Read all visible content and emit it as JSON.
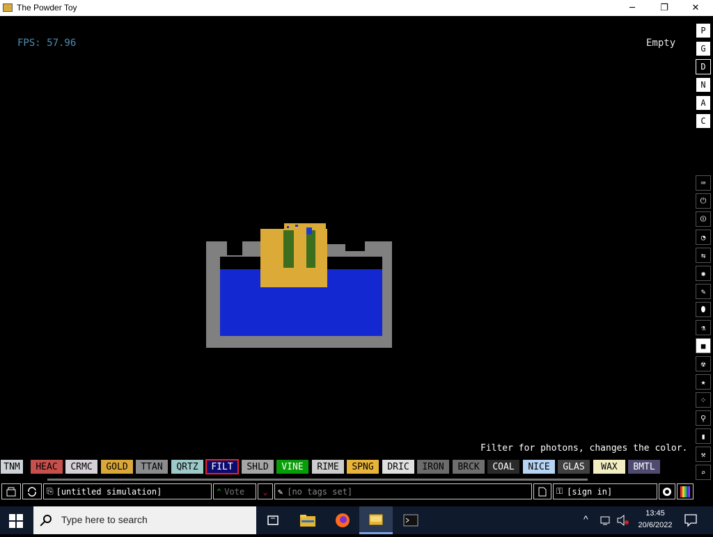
{
  "window": {
    "title": "The Powder Toy",
    "minimize_glyph": "─",
    "maximize_glyph": "❐",
    "close_glyph": "✕"
  },
  "sim": {
    "fps": "FPS: 57.96",
    "hover_status": "Empty",
    "tooltip": "Filter for photons, changes the color."
  },
  "right_menu": {
    "top_buttons": [
      "P",
      "G",
      "D",
      "N",
      "A",
      "C"
    ],
    "selected_top": "D",
    "category_icons": [
      "keyboard-icon",
      "plug-icon",
      "power-icon",
      "gauge-icon",
      "arrows-icon",
      "spray-icon",
      "pen-icon",
      "drop-icon",
      "flask-icon",
      "square-icon",
      "radioactive-icon",
      "star-icon",
      "dots-icon",
      "bulb-icon",
      "bookmark-icon",
      "tools-icon",
      "search-icon"
    ],
    "selected_category": "square-icon"
  },
  "elements": [
    {
      "label": "TNM",
      "bg": "#cfd3d8",
      "fg": "#000000"
    },
    {
      "label": "HEAC",
      "bg": "#c8504c",
      "fg": "#000000"
    },
    {
      "label": "CRMC",
      "bg": "#d6d1d6",
      "fg": "#000000"
    },
    {
      "label": "GOLD",
      "bg": "#d9a73a",
      "fg": "#000000"
    },
    {
      "label": "TTAN",
      "bg": "#8a8c8e",
      "fg": "#000000"
    },
    {
      "label": "QRTZ",
      "bg": "#9ec9c9",
      "fg": "#000000"
    },
    {
      "label": "FILT",
      "bg": "#0b0a6e",
      "fg": "#ffffff",
      "selected": true
    },
    {
      "label": "SHLD",
      "bg": "#a6a6a6",
      "fg": "#000000"
    },
    {
      "label": "VINE",
      "bg": "#089c08",
      "fg": "#ffffff"
    },
    {
      "label": "RIME",
      "bg": "#cdcdcd",
      "fg": "#000000"
    },
    {
      "label": "SPNG",
      "bg": "#e7b33a",
      "fg": "#000000"
    },
    {
      "label": "DRIC",
      "bg": "#e0e0e0",
      "fg": "#000000"
    },
    {
      "label": "IRON",
      "bg": "#6b6b6b",
      "fg": "#000000"
    },
    {
      "label": "BRCK",
      "bg": "#6e6e6e",
      "fg": "#000000"
    },
    {
      "label": "COAL",
      "bg": "#2a2a2a",
      "fg": "#ffffff"
    },
    {
      "label": "NICE",
      "bg": "#b6d4f4",
      "fg": "#000000"
    },
    {
      "label": "GLAS",
      "bg": "#404040",
      "fg": "#ffffff"
    },
    {
      "label": "WAX",
      "bg": "#f2eec2",
      "fg": "#000000"
    },
    {
      "label": "BMTL",
      "bg": "#4e4a70",
      "fg": "#ffffff"
    }
  ],
  "bottom_bar": {
    "simulation_name": "[untitled simulation]",
    "vote_label": "Vote",
    "tags": "[no tags set]",
    "sign_in": "[sign in]"
  },
  "taskbar": {
    "search_placeholder": "Type here to search",
    "time": "13:45",
    "date": "20/6/2022",
    "apps": [
      "task-view-icon",
      "file-explorer-icon",
      "firefox-icon",
      "powder-toy-icon",
      "terminal-icon"
    ]
  },
  "colors": {
    "water": "#1428d2",
    "container": "#808080",
    "gold": "#dcaa37",
    "vine": "#3c6e1e",
    "fps": "#4f8fb8"
  }
}
